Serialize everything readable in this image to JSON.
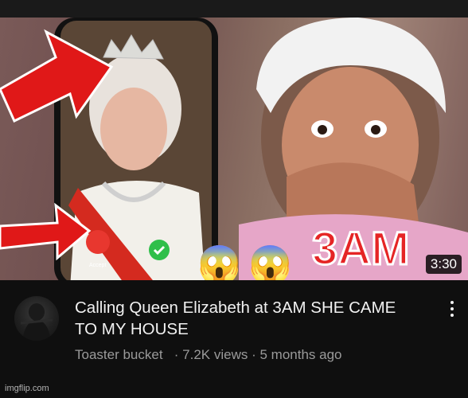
{
  "video": {
    "duration": "3:30",
    "title": "Calling Queen Elizabeth at 3AM SHE CAME TO MY HOUSE",
    "channel": "Toaster bucket",
    "views": "7.2K views",
    "age": "5 months ago",
    "separator": "·",
    "thumbnail": {
      "overlay_text": "3AM",
      "call_accept_label": "Accept",
      "emoji": "😱"
    }
  },
  "watermark": "imgflip.com",
  "colors": {
    "background": "#0f0f0f",
    "title": "#f1f1f1",
    "meta": "#9a9a9a",
    "arrow_red": "#e01818",
    "accept_green": "#2fbf4a",
    "decline_red": "#e8372f"
  },
  "icons": [
    "more-vert-icon",
    "call-accept-icon",
    "call-decline-icon",
    "arrow-icon"
  ]
}
